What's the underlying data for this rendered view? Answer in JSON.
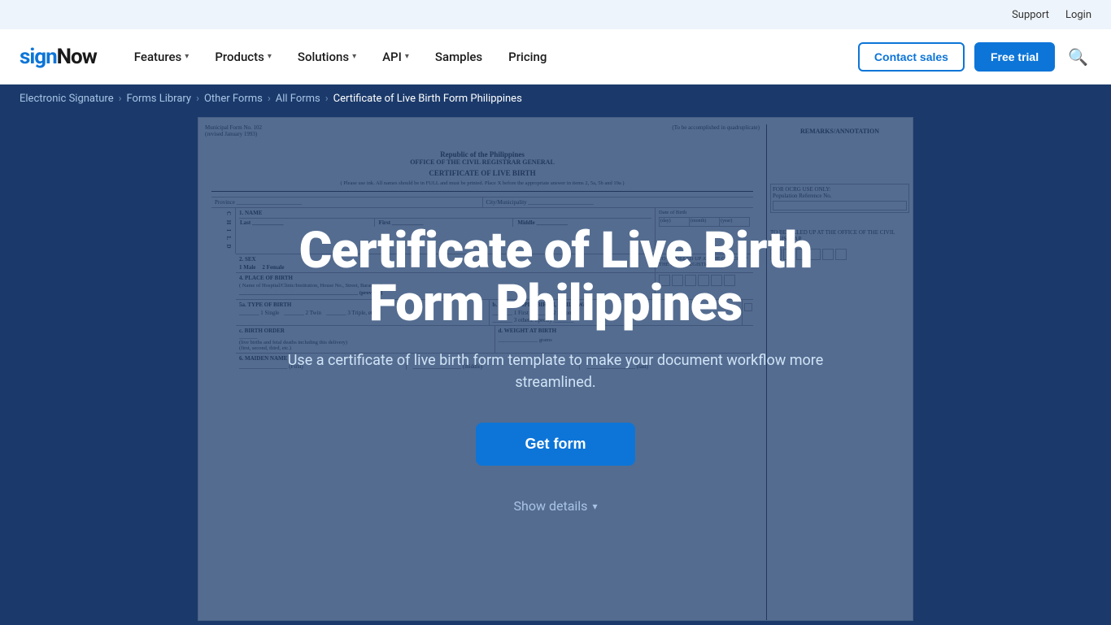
{
  "topbar": {
    "support_label": "Support",
    "login_label": "Login"
  },
  "nav": {
    "logo_sign": "sign",
    "logo_now": "Now",
    "features_label": "Features",
    "products_label": "Products",
    "solutions_label": "Solutions",
    "api_label": "API",
    "samples_label": "Samples",
    "pricing_label": "Pricing",
    "contact_sales_label": "Contact sales",
    "free_trial_label": "Free trial"
  },
  "breadcrumb": {
    "electronic_signature": "Electronic Signature",
    "forms_library": "Forms Library",
    "other_forms": "Other Forms",
    "all_forms": "All Forms",
    "current": "Certificate of Live Birth Form Philippines"
  },
  "hero": {
    "title": "Certificate of Live Birth Form Philippines",
    "subtitle": "Use a certificate of live birth form template to make your document workflow more streamlined.",
    "get_form_label": "Get form",
    "show_details_label": "Show details"
  },
  "form_doc": {
    "muni_label": "Municipal Form No. 102",
    "muni_sub": "(revised January 1993)",
    "quad_label": "(To be accomplished in quadruplicate)",
    "remarks_label": "REMARKS/ANNOTATION",
    "republic_label": "Republic of the Philippines",
    "office_label": "OFFICE OF THE CIVIL REGISTRAR GENERAL",
    "certificate_label": "CERTIFICATE OF LIVE BIRTH",
    "instructions": "( Please use ink. All names should be in FULL and must be printed. Place X before the appropriate answer in items 2, 5a, 5b and 19a )",
    "province_label": "Province",
    "city_label": "City/Municipality",
    "name_label": "1. NAME",
    "sex_label": "2. SEX",
    "male_label": "1  Male",
    "female_label": "2  Female",
    "place_of_birth_label": "4. PLACE OF BIRTH",
    "hospital_label": "( Name of Hospital/Clinic/Institution, House No., Street, Barangay)",
    "province2_label": "(province)",
    "type_of_birth_label": "5a. TYPE OF BIRTH",
    "single_label": "1  Single",
    "twin_label": "2  Twin",
    "triple_label": "3  Triple, etc",
    "multiple_birth_label": "b. IF MULTIPLE BIRTH, CHILD WAS",
    "first_label": "1  First",
    "second_label": "2  Second",
    "others_label": "3  others. Specify",
    "birth_order_label": "c. BIRTH ORDER",
    "live_births_label": "(live births and fetal deaths including this delivery)",
    "first_second_label": "(first, second, third, etc.)",
    "weight_label": "d. WEIGHT AT BIRTH",
    "grams_label": "grams",
    "maiden_name_label": "6. MAIDEN NAME",
    "first_label2": "(First)",
    "middle_label": "(middle)",
    "last_label": "(last)",
    "for_ocrg_label": "FOR OCRG USE ONLY:",
    "population_ref_label": "Population Reference No.",
    "to_be_filled_label": "TO BE FILLED UP AT THE OFFICE OF THE CIVIL REGISTRAR"
  },
  "colors": {
    "nav_bg": "#ffffff",
    "breadcrumb_bg": "#1b3a6b",
    "hero_bg": "#1b3a6b",
    "accent_blue": "#0d75d8",
    "logo_blue": "#0d75d8"
  }
}
